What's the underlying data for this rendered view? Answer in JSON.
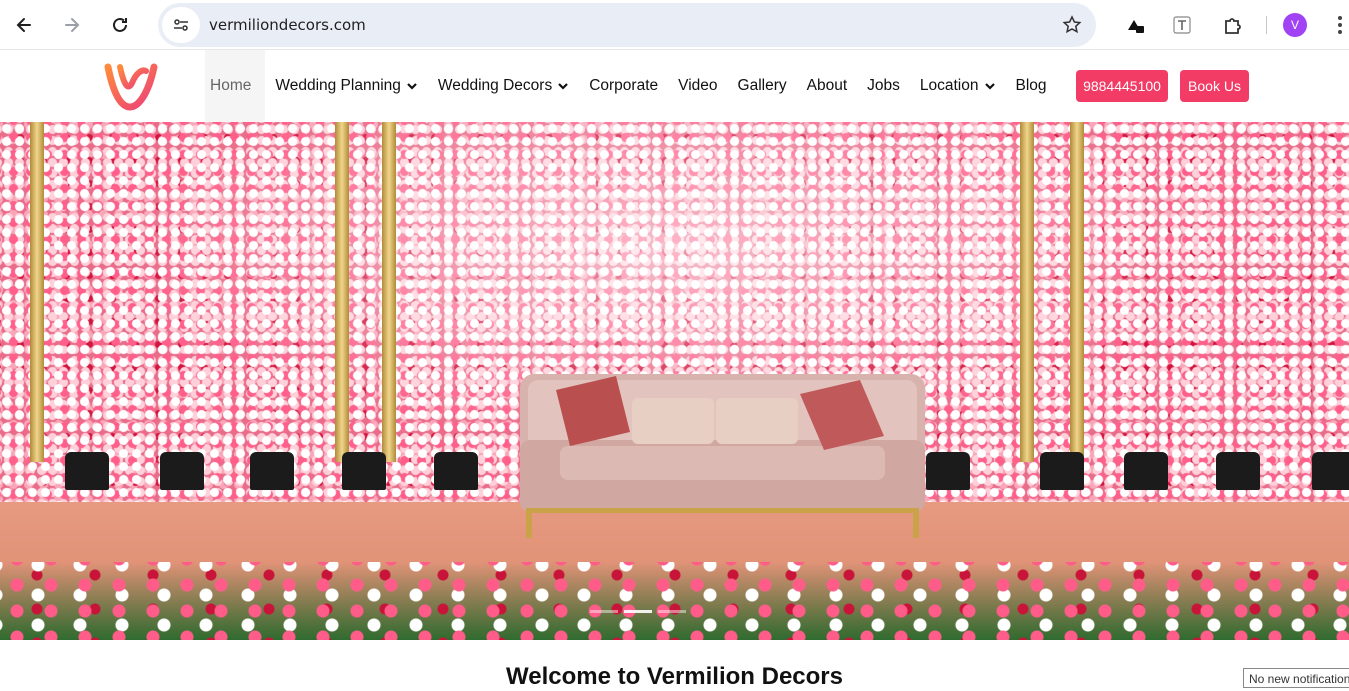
{
  "browser": {
    "url": "vermiliondecors.com",
    "profile_initial": "V"
  },
  "site": {
    "menu": [
      {
        "label": "Home",
        "active": true,
        "dropdown": false
      },
      {
        "label": "Wedding Planning",
        "active": false,
        "dropdown": true
      },
      {
        "label": "Wedding Decors",
        "active": false,
        "dropdown": true
      },
      {
        "label": "Corporate",
        "active": false,
        "dropdown": false
      },
      {
        "label": "Video",
        "active": false,
        "dropdown": false
      },
      {
        "label": "Gallery",
        "active": false,
        "dropdown": false
      },
      {
        "label": "About",
        "active": false,
        "dropdown": false
      },
      {
        "label": "Jobs",
        "active": false,
        "dropdown": false
      },
      {
        "label": "Location",
        "active": false,
        "dropdown": true
      },
      {
        "label": "Blog",
        "active": false,
        "dropdown": false
      }
    ],
    "phone_button": "9884445100",
    "book_button": "Book Us",
    "accent_color": "#f23b65"
  },
  "hero": {
    "slide_count": 3,
    "active_slide": 2
  },
  "main": {
    "welcome_heading": "Welcome to Vermilion Decors"
  },
  "notification": {
    "text": "No new notifications"
  }
}
